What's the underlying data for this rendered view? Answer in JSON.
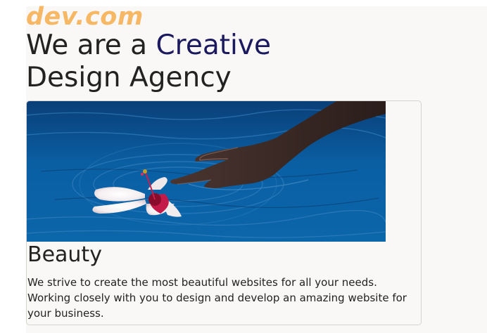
{
  "brand": {
    "logo_text": "dev.com"
  },
  "hero": {
    "title_prefix": "We are a ",
    "title_accent": "Creative",
    "title_line2": "Design Agency"
  },
  "card": {
    "image_subject": "hand touching water with hibiscus flower",
    "title": "Beauty",
    "body": "We strive to create the most beautiful websites for all your needs. Working closely with you to design and develop an amazing website for your business."
  },
  "colors": {
    "logo": "#f7b865",
    "accent": "#1c1a5e",
    "page_background": "#f9f8f6",
    "text": "#222222",
    "water": "#0a5fa3"
  }
}
